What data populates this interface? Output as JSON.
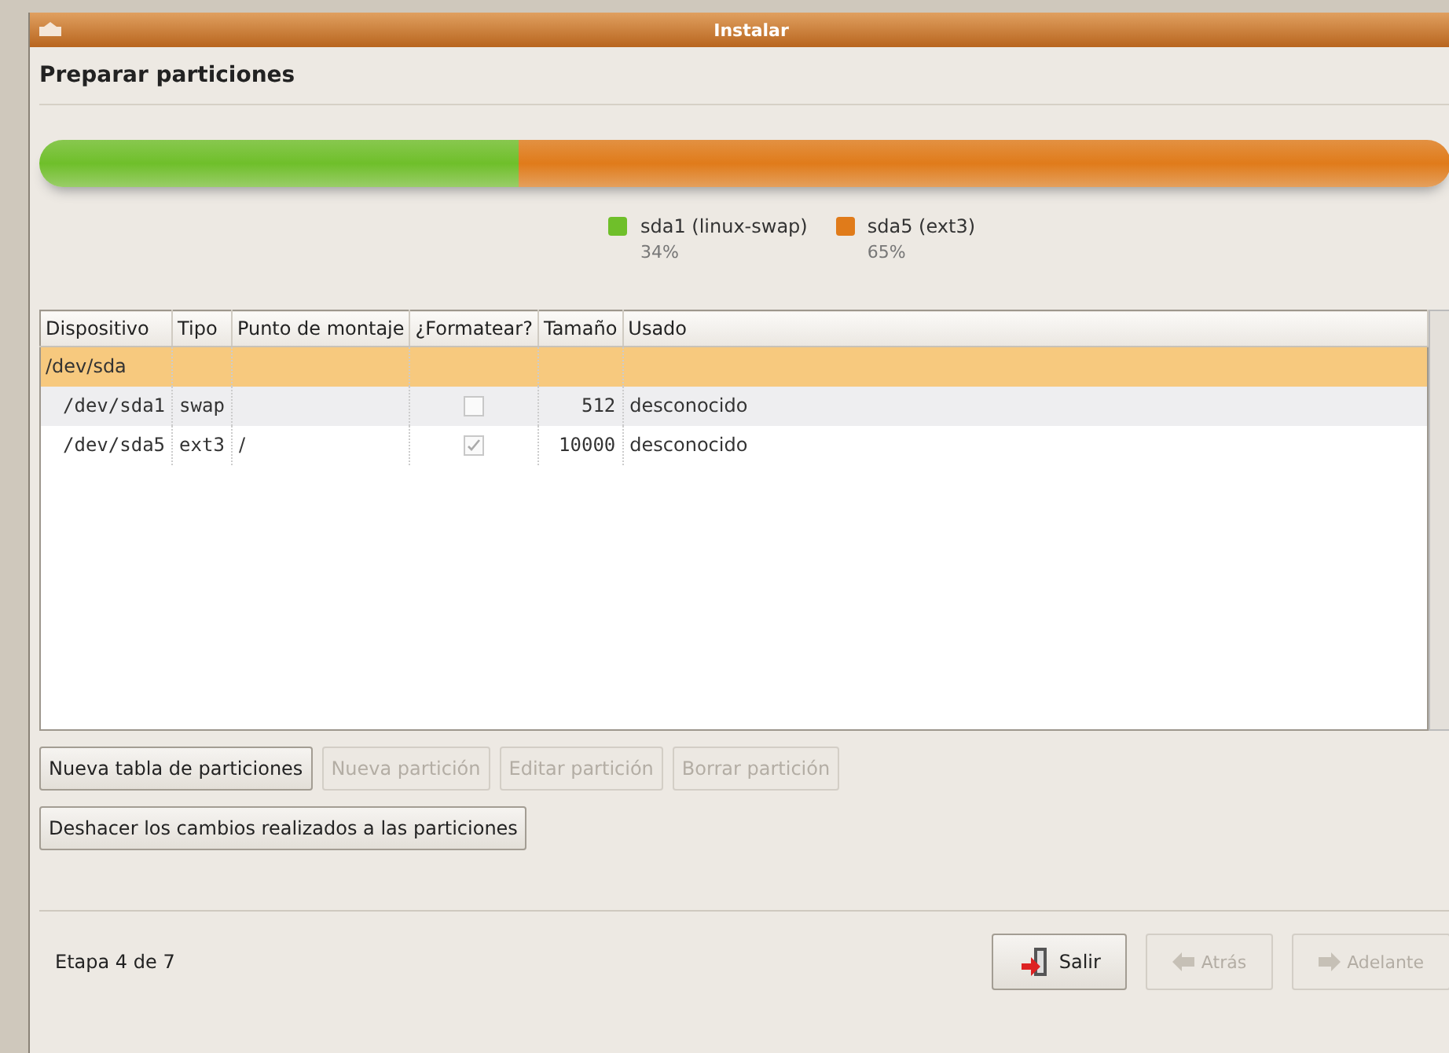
{
  "window": {
    "title": "Instalar"
  },
  "heading": "Preparar particiones",
  "partitions_bar": [
    {
      "label": "sda1 (linux-swap)",
      "percent": "34%",
      "color": "#6fbf2a",
      "level": 0.34
    },
    {
      "label": "sda5 (ext3)",
      "percent": "65%",
      "color": "#e07b1a",
      "level": 0.66
    }
  ],
  "table": {
    "columns": [
      "Dispositivo",
      "Tipo",
      "Punto de montaje",
      "¿Formatear?",
      "Tamaño",
      "Usado"
    ],
    "rows": [
      {
        "device": "/dev/sda",
        "selected": true,
        "children": [
          {
            "device": "/dev/sda1",
            "type": "swap",
            "format": false,
            "size": "512",
            "used": "desconocido",
            "selected": false
          },
          {
            "device": "/dev/sda5",
            "type": "ext3",
            "mount": "/",
            "format": true,
            "size": "10000",
            "used": "desconocido",
            "selected": false
          }
        ]
      }
    ]
  },
  "buttons_row1": [
    {
      "label": "Nueva tabla de particiones",
      "disabled": false
    },
    {
      "label": "Nueva partición",
      "disabled": true
    },
    {
      "label": "Editar partición",
      "disabled": true
    },
    {
      "label": "Borrar partición",
      "disabled": true
    }
  ],
  "buttons_row2": [
    {
      "label": "Deshacer los cambios realizados a las particiones",
      "disabled": false
    }
  ],
  "footer": {
    "step": "Etapa 4 de 7",
    "buttons": [
      {
        "kind": "quit",
        "label": "Salir",
        "disabled": false
      },
      {
        "kind": "back",
        "label": "Atrás",
        "disabled": true
      },
      {
        "kind": "forward",
        "label": "Adelante",
        "disabled": true
      }
    ]
  }
}
